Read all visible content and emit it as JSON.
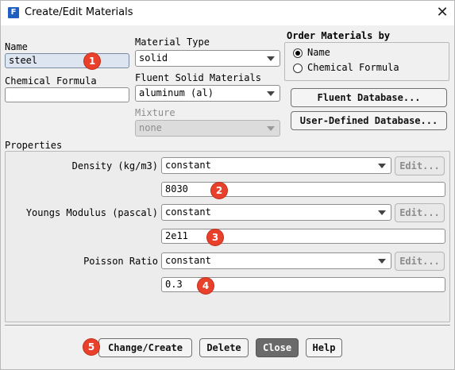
{
  "window": {
    "title": "Create/Edit Materials",
    "app_icon_letter": "F"
  },
  "name": {
    "label": "Name",
    "value": "steel"
  },
  "chemical_formula": {
    "label": "Chemical Formula",
    "value": ""
  },
  "material_type": {
    "label": "Material Type",
    "value": "solid"
  },
  "fluent_solid_materials": {
    "label": "Fluent Solid Materials",
    "value": "aluminum (al)"
  },
  "mixture": {
    "label": "Mixture",
    "value": "none"
  },
  "order_by": {
    "label": "Order Materials by",
    "options": [
      {
        "label": "Name",
        "selected": true
      },
      {
        "label": "Chemical Formula",
        "selected": false
      }
    ]
  },
  "database_buttons": {
    "fluent": "Fluent Database...",
    "user_defined": "User-Defined Database..."
  },
  "properties": {
    "label": "Properties",
    "rows": [
      {
        "label": "Density (kg/m3)",
        "method": "constant",
        "edit": "Edit...",
        "value": "8030"
      },
      {
        "label": "Youngs Modulus (pascal)",
        "method": "constant",
        "edit": "Edit...",
        "value": "2e11"
      },
      {
        "label": "Poisson Ratio",
        "method": "constant",
        "edit": "Edit...",
        "value": "0.3"
      }
    ]
  },
  "actions": {
    "change_create": "Change/Create",
    "delete": "Delete",
    "close": "Close",
    "help": "Help"
  },
  "annotations": [
    "1",
    "2",
    "3",
    "4",
    "5"
  ],
  "colors": {
    "badge": "#e8402a",
    "close_button": "#6a6a6a",
    "name_field": "#dde6f0"
  }
}
